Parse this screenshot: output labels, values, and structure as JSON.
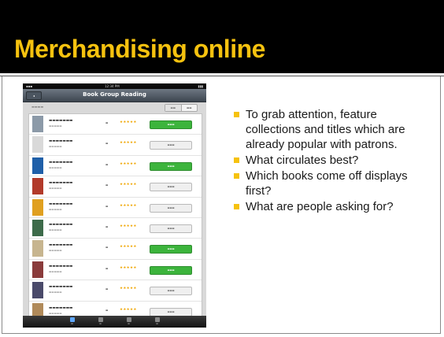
{
  "slide": {
    "title": "Merchandising online",
    "bullets": [
      "To grab attention, feature collections and titles which are already popular with patrons.",
      "What circulates best?",
      "Which books come off displays first?",
      "What are people asking for?"
    ]
  },
  "colors": {
    "title": "#f6c20f",
    "bullet": "#f6c20f",
    "header_bg": "#000000",
    "borrow_button": "#3cb43c"
  },
  "ipad": {
    "nav_title": "Book Group Reading",
    "status_time": "12:34 PM"
  }
}
